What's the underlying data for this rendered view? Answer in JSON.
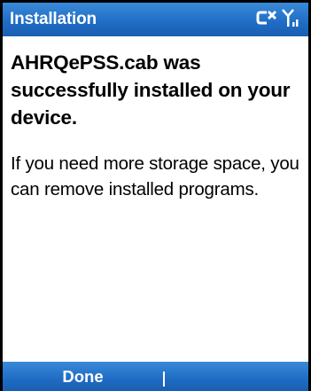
{
  "titlebar": {
    "title": "Installation",
    "icons": [
      "connectivity-icon",
      "signal-strength-icon"
    ]
  },
  "content": {
    "headline": "AHRQePSS.cab was successfully installed on your device.",
    "message": "If you need more storage space, you can remove installed programs."
  },
  "softkeys": {
    "left_label": "Done",
    "right_label": ""
  },
  "colors": {
    "bar_top": "#3a8ad8",
    "bar_bottom": "#1a5fb0",
    "background": "#ffffff",
    "text": "#000000"
  }
}
